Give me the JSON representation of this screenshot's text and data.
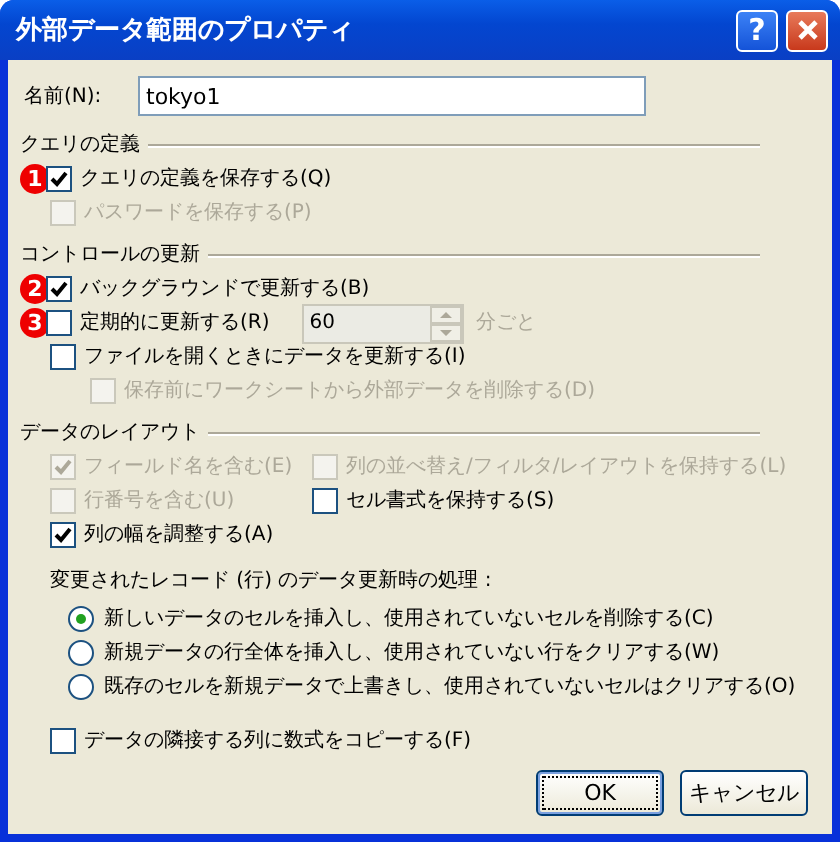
{
  "window": {
    "title": "外部データ範囲のプロパティ",
    "help": "?"
  },
  "name_field": {
    "label": "名前(N):",
    "value": "tokyo1"
  },
  "sections": [
    {
      "title": "クエリの定義",
      "items": [
        {
          "label": "クエリの定義を保存する(Q)",
          "checked": true,
          "disabled": false,
          "callout": "1"
        },
        {
          "label": "パスワードを保存する(P)",
          "checked": false,
          "disabled": true
        }
      ]
    },
    {
      "title": "コントロールの更新",
      "items": [
        {
          "label": "バックグラウンドで更新する(B)",
          "checked": true,
          "disabled": false,
          "callout": "2"
        },
        {
          "label": "定期的に更新する(R)",
          "checked": false,
          "disabled": false,
          "callout": "3",
          "spinner": {
            "value": "60",
            "unit": "分ごと",
            "disabled": true
          }
        },
        {
          "label": "ファイルを開くときにデータを更新する(I)",
          "checked": false,
          "disabled": false,
          "children": [
            {
              "label": "保存前にワークシートから外部データを削除する(D)",
              "checked": false,
              "disabled": true
            }
          ]
        }
      ]
    },
    {
      "title": "データのレイアウト",
      "columns": [
        [
          {
            "label": "フィールド名を含む(E)",
            "checked": true,
            "disabled": true
          },
          {
            "label": "行番号を含む(U)",
            "checked": false,
            "disabled": true
          },
          {
            "label": "列の幅を調整する(A)",
            "checked": true,
            "disabled": false
          }
        ],
        [
          {
            "label": "列の並べ替え/フィルタ/レイアウトを保持する(L)",
            "checked": false,
            "disabled": true
          },
          {
            "label": "セル書式を保持する(S)",
            "checked": false,
            "disabled": false
          }
        ]
      ],
      "prompt": "変更されたレコード (行) のデータ更新時の処理 :",
      "options": [
        {
          "label": "新しいデータのセルを挿入し、使用されていないセルを削除する(C)",
          "selected": true
        },
        {
          "label": "新規データの行全体を挿入し、使用されていない行をクリアする(W)",
          "selected": false
        },
        {
          "label": "既存のセルを新規データで上書きし、使用されていないセルはクリアする(O)",
          "selected": false
        }
      ],
      "bottom_checkbox": {
        "label": "データの隣接する列に数式をコピーする(F)",
        "checked": false,
        "disabled": false
      }
    }
  ],
  "buttons": [
    {
      "label": "OK",
      "default": true
    },
    {
      "label": "キャンセル",
      "default": false
    }
  ]
}
